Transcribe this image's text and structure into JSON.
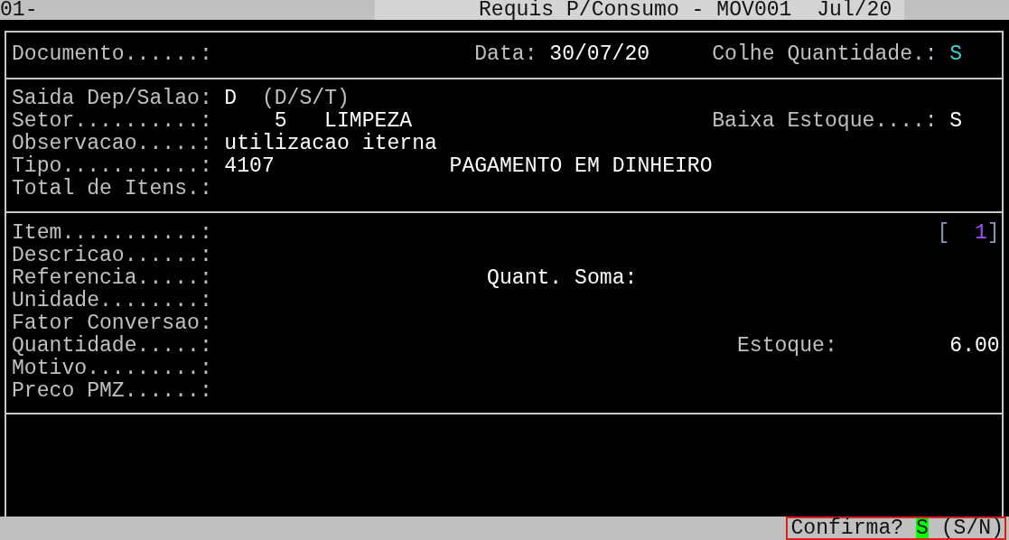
{
  "title_bar": {
    "session": "01-",
    "title": "Requis P/Consumo - MOV001  Jul/20"
  },
  "header": {
    "documento_label": "Documento......:",
    "data_label": "Data:",
    "data_value": "30/07/20",
    "colhe_label": "Colhe Quantidade.:",
    "colhe_value": "S"
  },
  "details": {
    "saida_label": "Saida Dep/Salao:",
    "saida_value": "D",
    "saida_options": "(D/S/T)",
    "setor_label": "Setor..........:",
    "setor_code": "5",
    "setor_name": "LIMPEZA",
    "baixa_label": "Baixa Estoque....:",
    "baixa_value": "S",
    "observacao_label": "Observacao.....:",
    "observacao_value": "utilizacao iterna",
    "tipo_label": "Tipo...........:",
    "tipo_code": "4107",
    "tipo_name": "PAGAMENTO EM DINHEIRO",
    "total_label": "Total de Itens.:"
  },
  "item": {
    "item_label": "Item...........:",
    "counter_open": "[",
    "counter_value": "1",
    "counter_close": "]",
    "descricao_label": "Descricao......:",
    "referencia_label": "Referencia.....:",
    "quant_soma_label": "Quant. Soma:",
    "unidade_label": "Unidade........:",
    "fator_label": "Fator Conversao:",
    "quantidade_label": "Quantidade.....:",
    "estoque_label": "Estoque:",
    "estoque_value": "6.00",
    "motivo_label": "Motivo.........:",
    "preco_label": "Preco PMZ......:"
  },
  "status_bar": {
    "prompt": "Confirma?",
    "value": "S",
    "options": "(S/N)"
  }
}
